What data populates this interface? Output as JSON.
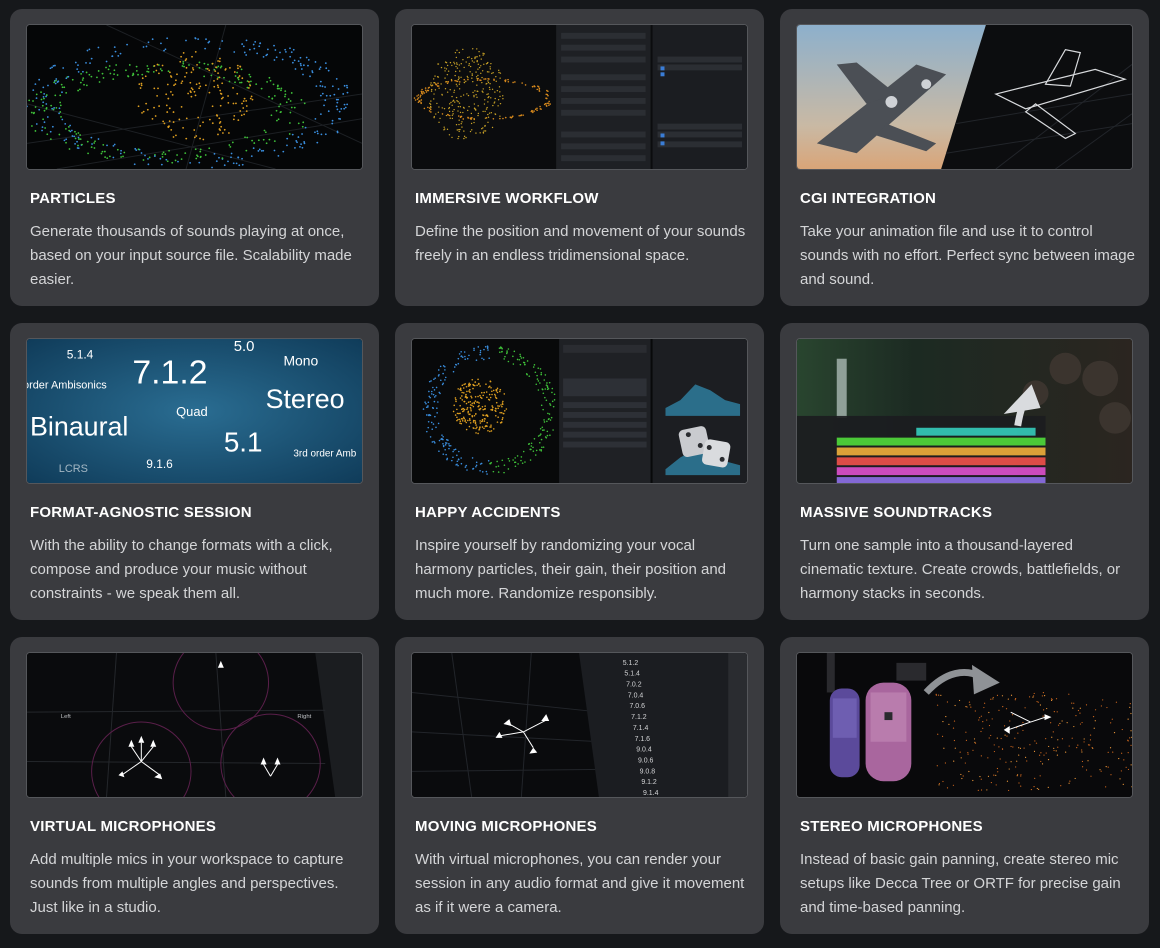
{
  "cards": [
    {
      "title": "PARTICLES",
      "desc": "Generate thousands of sounds playing at once, based on your input source file. Scalability made easier."
    },
    {
      "title": "IMMERSIVE WORKFLOW",
      "desc": "Define the position and movement of your sounds freely in an endless tridimensional space."
    },
    {
      "title": "CGI INTEGRATION",
      "desc": "Take your animation file and use it to control sounds with no effort. Perfect sync between image and sound."
    },
    {
      "title": "FORMAT-AGNOSTIC SESSION",
      "desc": "With the ability to change formats with a click, compose and produce your music without constraints - we speak them all."
    },
    {
      "title": "HAPPY ACCIDENTS",
      "desc": "Inspire yourself by randomizing your vocal harmony particles, their gain, their position and much more. Randomize responsibly."
    },
    {
      "title": "MASSIVE SOUNDTRACKS",
      "desc": "Turn one sample into a thousand-layered cinematic texture. Create crowds, battlefields, or harmony stacks in seconds."
    },
    {
      "title": "VIRTUAL MICROPHONES",
      "desc": "Add multiple mics in your workspace to capture sounds from multiple angles and perspectives. Just like in a studio."
    },
    {
      "title": "MOVING MICROPHONES",
      "desc": "With virtual microphones, you can render your session in any audio format and give it movement as if it were a camera."
    },
    {
      "title": "STEREO MICROPHONES",
      "desc": "Instead of basic gain panning, create stereo mic setups like Decca Tree or ORTF for precise gain and time-based panning."
    }
  ],
  "formats": {
    "f514": "5.1.4",
    "f712": "7.1.2",
    "f50": "5.0",
    "mono": "Mono",
    "ambi": "order Ambisonics",
    "stereo": "Stereo",
    "quad": "Quad",
    "binaural": "Binaural",
    "f51": "5.1",
    "lcrs": "LCRS",
    "f916": "9.1.6",
    "ambi3": "3rd order Amb"
  },
  "format_list": [
    "5.1.2",
    "5.1.4",
    "7.0.2",
    "7.0.4",
    "7.0.6",
    "7.1.2",
    "7.1.4",
    "7.1.6",
    "9.0.4",
    "9.0.6",
    "9.0.8",
    "9.1.2",
    "9.1.4"
  ],
  "mic_labels": {
    "left": "Left",
    "right": "Right"
  },
  "colors": {
    "card_bg": "#3a3b3f",
    "page_bg": "#16181b",
    "particle_blue": "#3a8fe0",
    "particle_green": "#3fc23a",
    "particle_orange": "#e0a020"
  }
}
